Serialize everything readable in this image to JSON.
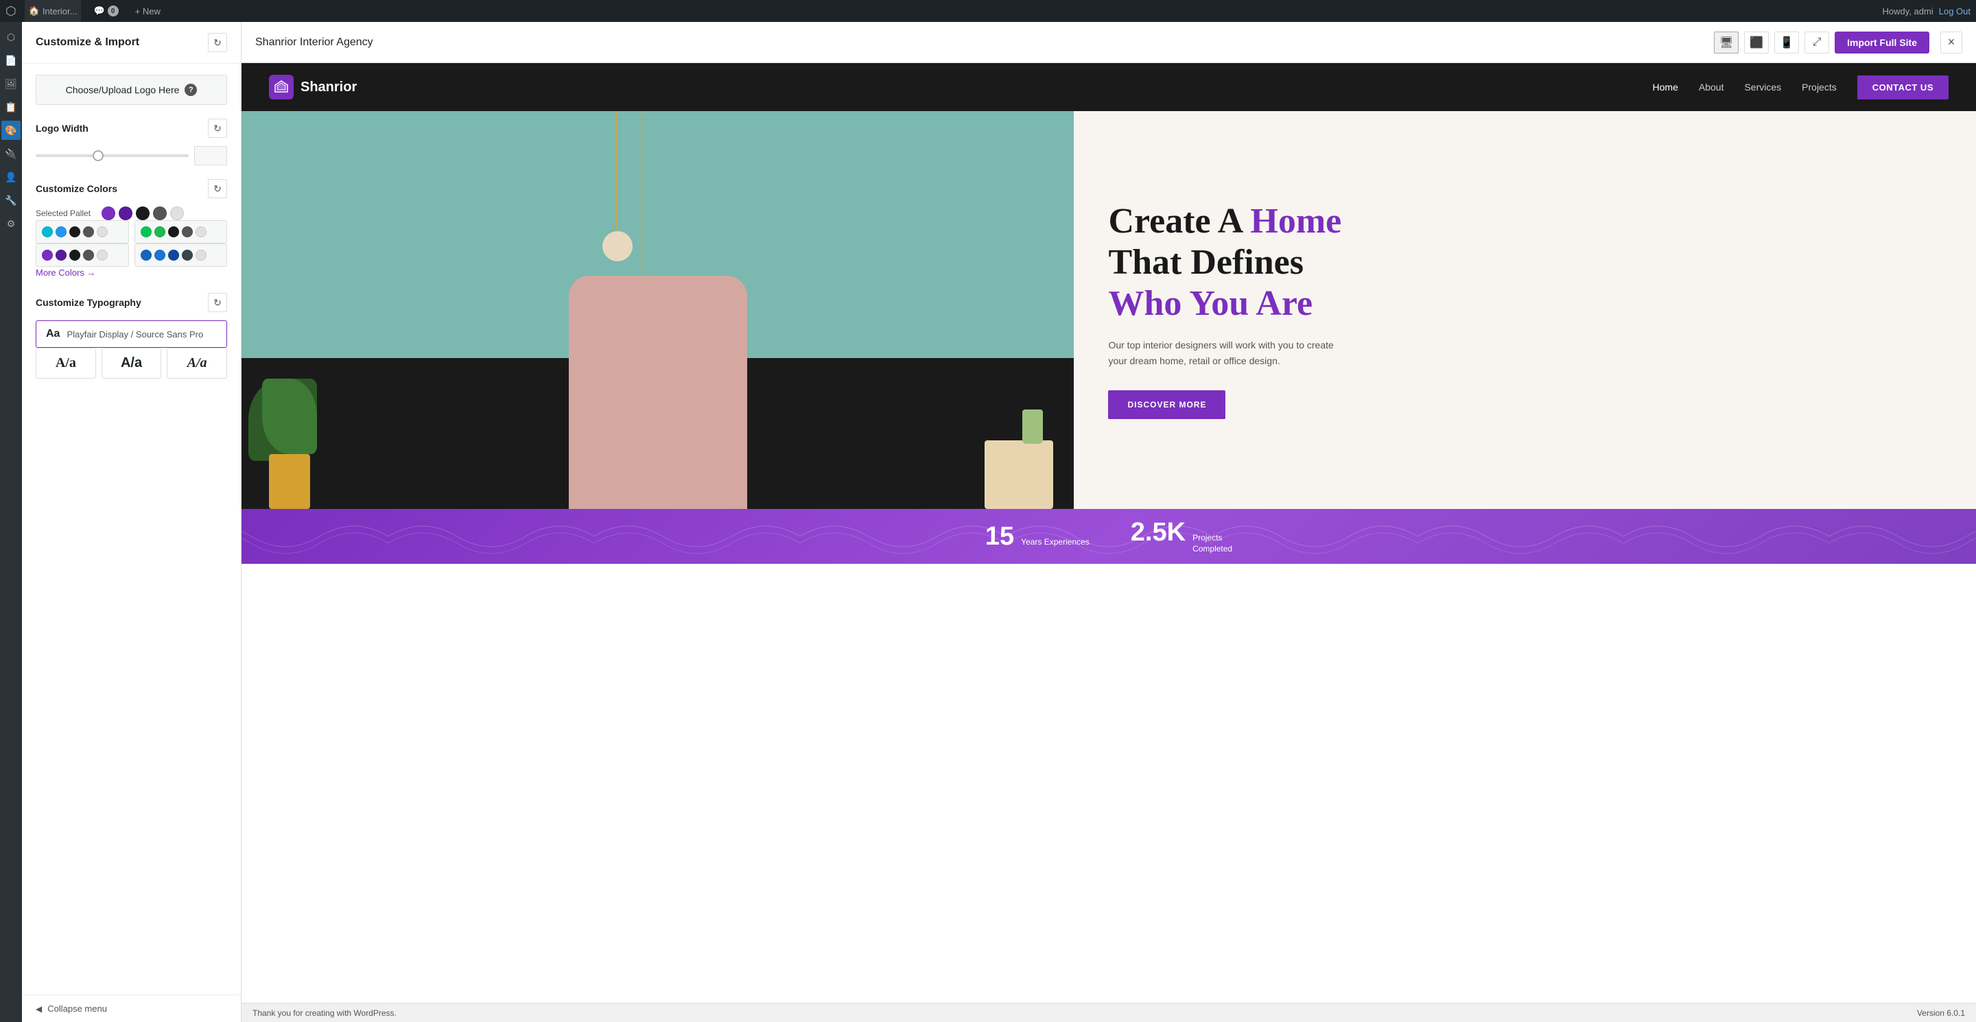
{
  "adminBar": {
    "logo": "W",
    "siteLabel": "Interior...",
    "commentIcon": "💬",
    "commentCount": "0",
    "newLabel": "+ New",
    "howdy": "Howdy, admi",
    "logOut": "Log Out"
  },
  "customizePanel": {
    "title": "Customize & Import",
    "logoSection": {
      "uploadLabel": "Choose/Upload Logo Here",
      "helpTooltip": "?"
    },
    "logoWidth": {
      "label": "Logo Width",
      "value": ""
    },
    "customizeColors": {
      "label": "Customize Colors",
      "selectedPalletLabel": "Selected Pallet",
      "moreColors": "More Colors →"
    },
    "customizeTypography": {
      "label": "Customize Typography",
      "fontLabel": "Aa",
      "fontName": "Playfair Display",
      "fontSeparator": "/",
      "fontSecondary": "Source Sans Pro",
      "variant1": "A/a",
      "variant2": "A/a",
      "variant3": "A/a"
    }
  },
  "previewHeader": {
    "title": "Shanrior Interior Agency",
    "importBtn": "Import Full Site",
    "closeBtn": "×"
  },
  "sitePreview": {
    "nav": {
      "logoText": "Shanrior",
      "links": [
        "Home",
        "About",
        "Services",
        "Projects"
      ],
      "activeLink": "Home",
      "ctaLabel": "CONTACT US"
    },
    "hero": {
      "headline1": "Create A ",
      "headlineAccent": "Home",
      "headline2": "That Defines",
      "headline3": "Who You Are",
      "subtitle": "Our top interior designers will work with you to create your dream home, retail or office design.",
      "ctaLabel": "DISCOVER MORE"
    },
    "stats": [
      {
        "number": "15",
        "line1": "Years Experiences"
      },
      {
        "number": "2.5K",
        "line1": "Projects",
        "line2": "Completed"
      }
    ]
  },
  "bottomBar": {
    "thankYou": "Thank you for creating with WordPress.",
    "version": "Version 6.0.1"
  },
  "colorPalettes": {
    "selected": [
      "#7b2fbe",
      "#5a1a9b",
      "#1a1a1a",
      "#555555",
      "#e0e0e0"
    ],
    "palette1a": [
      "#00bcd4",
      "#2196f3",
      "#1a1a1a",
      "#555555",
      "#e0e0e0"
    ],
    "palette1b": [
      "#00c853",
      "#1db954",
      "#1a1a1a",
      "#555555",
      "#e0e0e0"
    ],
    "palette2a": [
      "#7b2fbe",
      "#5a1a9b",
      "#1a1a1a",
      "#555555",
      "#e0e0e0"
    ],
    "palette2b": [
      "#1565c0",
      "#1976d2",
      "#0d47a1",
      "#37474f",
      "#e0e0e0"
    ]
  }
}
